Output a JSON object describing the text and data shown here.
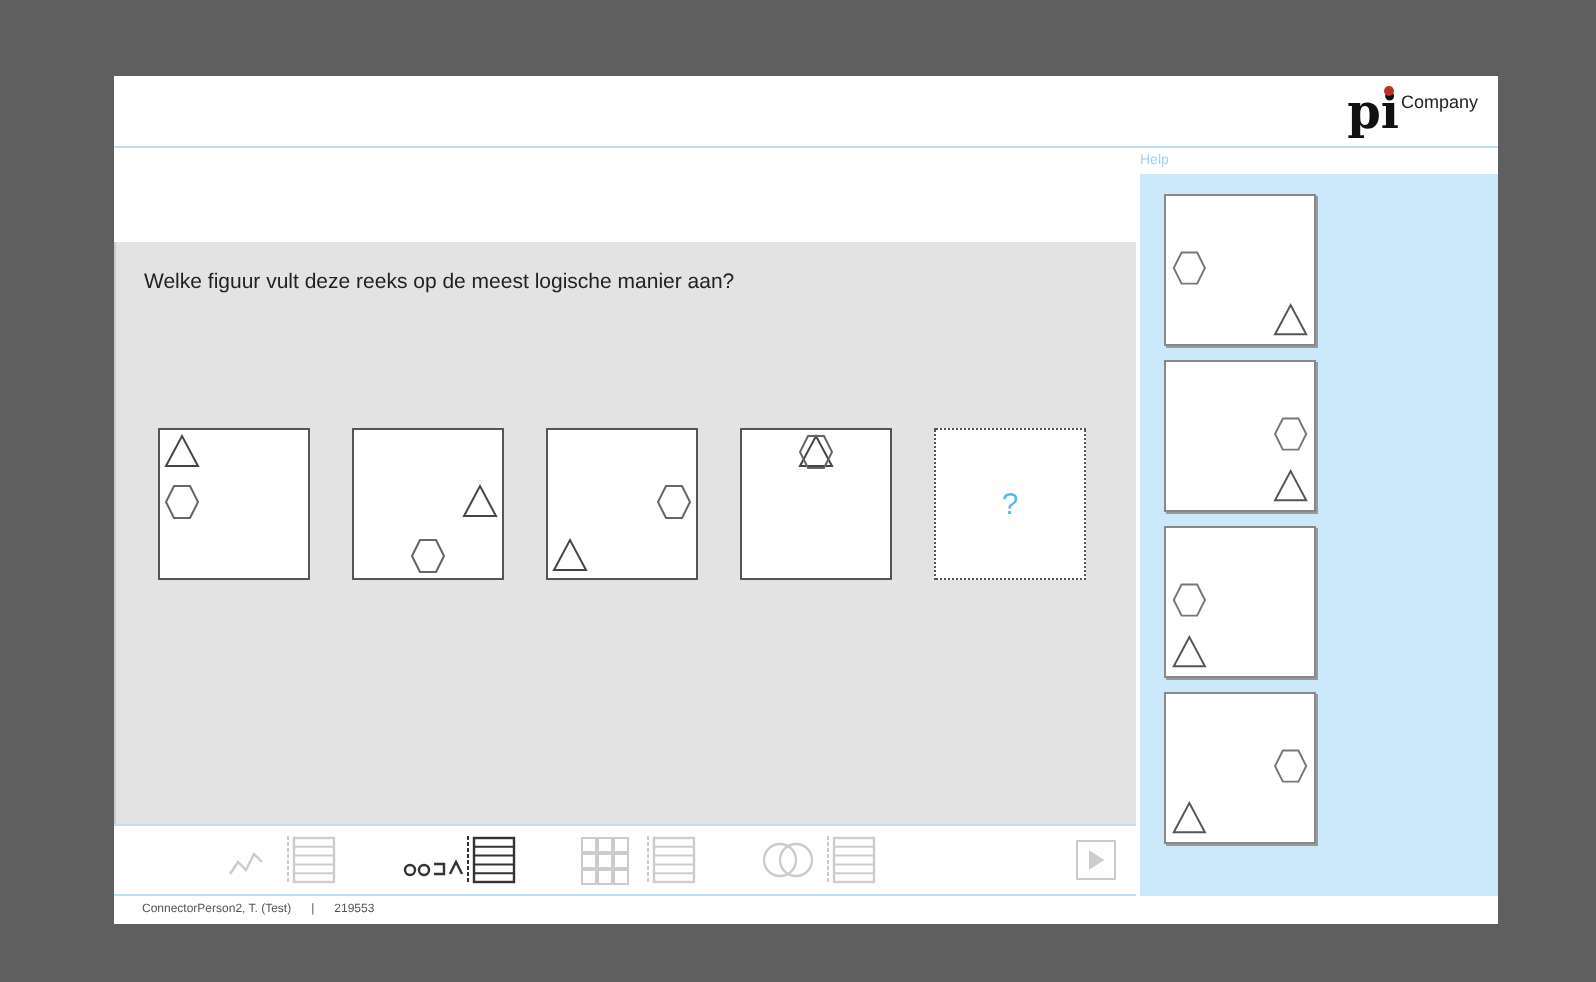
{
  "header": {
    "logo_mark": "pi",
    "logo_text": "Company"
  },
  "help": {
    "label": "Help"
  },
  "question": "Welke figuur vult deze reeks op de meest logische manier aan?",
  "sequence": [
    {
      "kind": "figure"
    },
    {
      "kind": "figure"
    },
    {
      "kind": "figure"
    },
    {
      "kind": "figure"
    },
    {
      "kind": "blank",
      "label": "?"
    }
  ],
  "options": [
    {
      "selected": false
    },
    {
      "selected": false
    },
    {
      "selected": false
    },
    {
      "selected": false
    }
  ],
  "tools": [
    {
      "kind": "numbers",
      "disabled": true
    },
    {
      "kind": "letters",
      "disabled": false
    },
    {
      "kind": "grid",
      "disabled": true
    },
    {
      "kind": "circles",
      "disabled": true
    }
  ],
  "next": {
    "disabled": true
  },
  "status_bar": {
    "user": "ConnectorPerson2, T. (Test)",
    "separator": "|",
    "code": "219553"
  }
}
